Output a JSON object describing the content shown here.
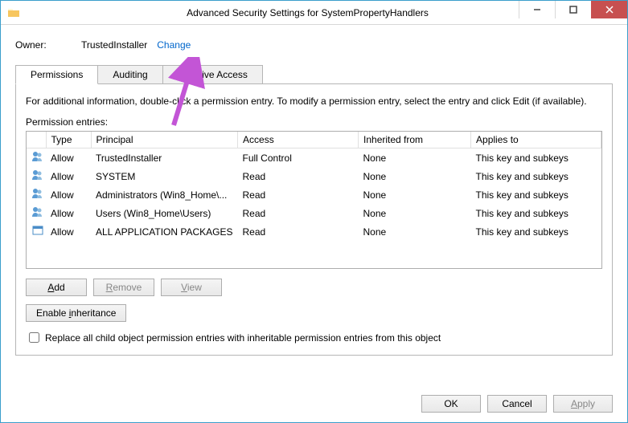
{
  "title": "Advanced Security Settings for SystemPropertyHandlers",
  "owner": {
    "label": "Owner:",
    "name": "TrustedInstaller",
    "change": "Change"
  },
  "tabs": [
    "Permissions",
    "Auditing",
    "Effective Access"
  ],
  "info": "For additional information, double-click a permission entry. To modify a permission entry, select the entry and click Edit (if available).",
  "entries_label": "Permission entries:",
  "columns": {
    "type": "Type",
    "principal": "Principal",
    "access": "Access",
    "inherited": "Inherited from",
    "applies": "Applies to"
  },
  "rows": [
    {
      "type": "Allow",
      "principal": "TrustedInstaller",
      "access": "Full Control",
      "inherited": "None",
      "applies": "This key and subkeys"
    },
    {
      "type": "Allow",
      "principal": "SYSTEM",
      "access": "Read",
      "inherited": "None",
      "applies": "This key and subkeys"
    },
    {
      "type": "Allow",
      "principal": "Administrators (Win8_Home\\...",
      "access": "Read",
      "inherited": "None",
      "applies": "This key and subkeys"
    },
    {
      "type": "Allow",
      "principal": "Users (Win8_Home\\Users)",
      "access": "Read",
      "inherited": "None",
      "applies": "This key and subkeys"
    },
    {
      "type": "Allow",
      "principal": "ALL APPLICATION PACKAGES",
      "access": "Read",
      "inherited": "None",
      "applies": "This key and subkeys"
    }
  ],
  "buttons": {
    "add": "Add",
    "remove": "Remove",
    "view": "View",
    "enable_inherit": "Enable inheritance",
    "ok": "OK",
    "cancel": "Cancel",
    "apply": "Apply"
  },
  "checkbox_label": "Replace all child object permission entries with inheritable permission entries from this object"
}
